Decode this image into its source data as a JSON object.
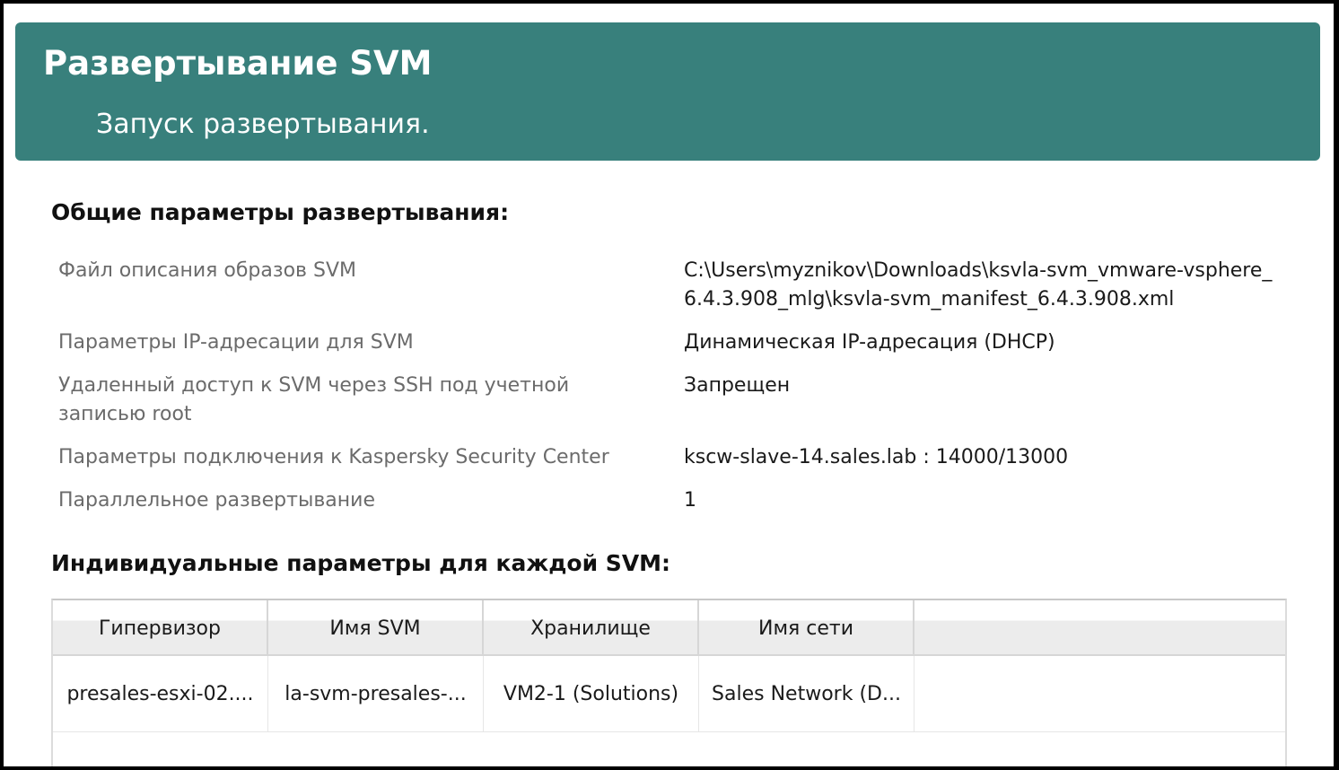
{
  "banner": {
    "title": "Развертывание SVM",
    "subtitle": "Запуск развертывания."
  },
  "general": {
    "heading": "Общие параметры развертывания:",
    "rows": [
      {
        "label": "Файл описания образов SVM",
        "value": "C:\\Users\\myznikov\\Downloads\\ksvla-svm_vmware-vsphere_6.4.3.908_mlg\\ksvla-svm_manifest_6.4.3.908.xml"
      },
      {
        "label": "Параметры IP-адресации для SVM",
        "value": "Динамическая IP-адресация (DHCP)"
      },
      {
        "label": "Удаленный доступ к SVM через SSH под учетной записью root",
        "value": "Запрещен"
      },
      {
        "label": "Параметры подключения к Kaspersky Security Center",
        "value": "kscw-slave-14.sales.lab : 14000/13000"
      },
      {
        "label": "Параллельное развертывание",
        "value": "1"
      }
    ]
  },
  "individual": {
    "heading": "Индивидуальные параметры для каждой SVM:",
    "columns": [
      "Гипервизор",
      "Имя SVM",
      "Хранилище",
      "Имя сети"
    ],
    "rows": [
      [
        "presales-esxi-02....",
        "la-svm-presales-...",
        "VM2-1 (Solutions)",
        "Sales Network (D..."
      ]
    ]
  }
}
